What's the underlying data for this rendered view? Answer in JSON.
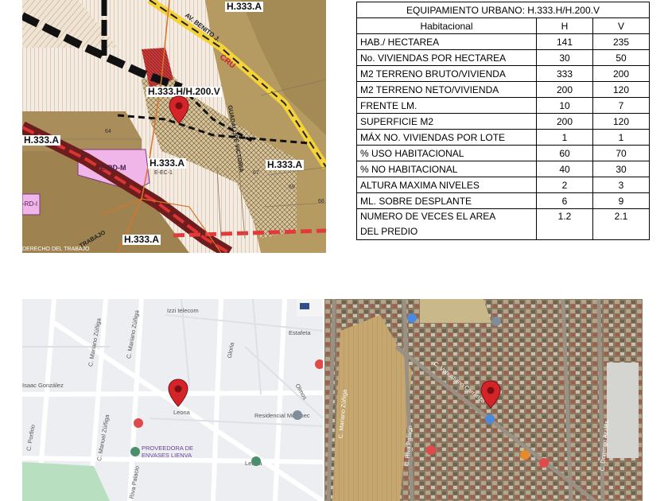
{
  "zoning_map": {
    "labels": {
      "top_right": "H.333.A",
      "main": "H.333.H/H.200.V",
      "left": "H.333.A",
      "center": "H.333.A",
      "right": "H.333.A",
      "bottom": "H.333.A",
      "ec": "E-EC-1",
      "rdm": "E-RD-M",
      "rdm_left": "-RD-I"
    },
    "roads": {
      "av": "AV. BENITO J.",
      "cru": "CRU",
      "guadalupe": "GUADALUPE VICTORIA",
      "trabajo": "TRABAJO",
      "derecho": "DERECHO DEL TRABAJO"
    },
    "block_numbers": [
      "64",
      "67",
      "69",
      "66"
    ]
  },
  "table": {
    "title": "EQUIPAMIENTO URBANO: H.333.H/H.200.V",
    "header": {
      "label": "Habitacional",
      "h": "H",
      "v": "V"
    },
    "rows": [
      {
        "label": "HAB./ HECTAREA",
        "h": "141",
        "v": "235"
      },
      {
        "label": "No. VIVIENDAS POR HECTAREA",
        "h": "30",
        "v": "50"
      },
      {
        "label": "M2 TERRENO BRUTO/VIVIENDA",
        "h": "333",
        "v": "200"
      },
      {
        "label": "M2 TERRENO NETO/VIVIENDA",
        "h": "200",
        "v": "120"
      },
      {
        "label": "FRENTE LM.",
        "h": "10",
        "v": "7"
      },
      {
        "label": "SUPERFICIE M2",
        "h": "200",
        "v": "120"
      },
      {
        "label": "MÁX NO. VIVIENDAS POR LOTE",
        "h": "1",
        "v": "1"
      },
      {
        "label": "% USO HABITACIONAL",
        "h": "60",
        "v": "70"
      },
      {
        "label": "% NO HABITACIONAL",
        "h": "40",
        "v": "30"
      },
      {
        "label": "ALTURA MAXIMA NIVELES",
        "h": "2",
        "v": "3"
      },
      {
        "label": "ML. SOBRE DESPLANTE",
        "h": "6",
        "v": "9"
      }
    ],
    "last_row": {
      "label_1": "NUMERO DE VECES EL AREA",
      "label_2": "DEL PREDIO",
      "h": "1.2",
      "v": "2.1"
    }
  },
  "street_map": {
    "labels": {
      "telecom": "Izzi telecom",
      "estafeta": "Estafeta",
      "residencial": "Residencial Metepec",
      "proveedora_1": "PROVEEDORA DE",
      "proveedora_2": "ENVASES LIENVA",
      "lecona": "Leona",
      "gonzalez": "Isaac González",
      "olmos": "Olmos",
      "mariano_zuniga": "C. Mariano Zúñiga",
      "mariano_zuniga_2": "C. Mariano Zúñiga",
      "manuel_zuniga": "C. Manuel Zúñiga",
      "riva_palacio": "Riva Palacio",
      "porfirio": "C. Porfirio",
      "gloria": "Gloria",
      "lerma": "Lerma"
    }
  },
  "satellite_map": {
    "labels": {
      "mariano_zuniga": "C. Mariano Zúñiga",
      "riva_palacio": "C. Riva Palacio",
      "domingo": "C. Domingo Azales",
      "carranza": "C. Venustiano Carranza"
    }
  }
}
